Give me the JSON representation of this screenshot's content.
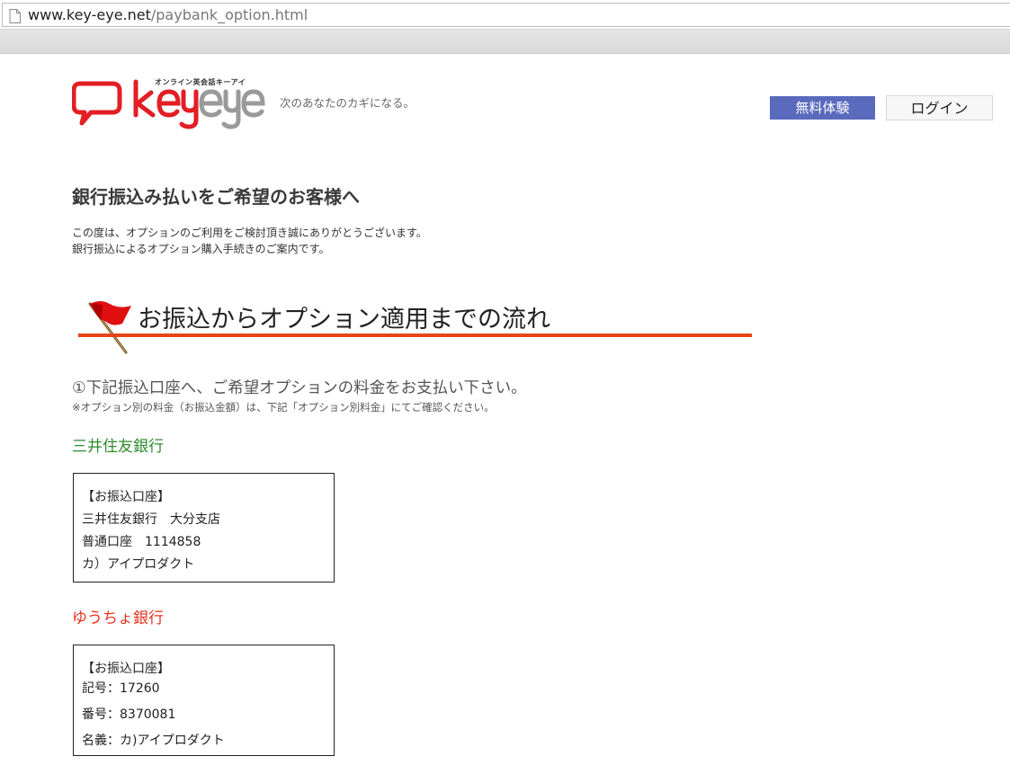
{
  "browser": {
    "url_domain": "www.key-eye.net",
    "url_path": "/paybank_option.html"
  },
  "header": {
    "logo_text": "keyeye",
    "logo_subtitle": "オンライン英会話キーアイ",
    "tagline": "次のあなたのカギになる。",
    "trial_button": "無料体験",
    "login_button": "ログイン",
    "colors": {
      "logo_red": "#e31e24",
      "logo_gray": "#9a9a9a",
      "trial_bg": "#5a6abd"
    }
  },
  "main": {
    "title": "銀行振込み払いをご希望のお客様へ",
    "intro": [
      "この度は、オプションのご利用をご検討頂き誠にありがとうございます。",
      "銀行振込によるオプション購入手続きのご案内です。"
    ],
    "section": {
      "icon": "red-flag-icon",
      "heading": "お振込からオプション適用までの流れ",
      "rule_color": "#e8441a"
    },
    "step1": {
      "text": "①下記振込口座へ、ご希望オプションの料金をお支払い下さい。",
      "note": "※オプション別の料金（お振込金額）は、下記「オプション別料金」にてご確認ください。"
    },
    "banks": [
      {
        "name": "三井住友銀行",
        "color": "#2e8b2e",
        "lines": [
          "【お振込口座】",
          "三井住友銀行　大分支店",
          "普通口座　1114858",
          "カ）アイプロダクト"
        ]
      },
      {
        "name": "ゆうちょ銀行",
        "color": "#e53320",
        "lines": [
          "【お振込口座】",
          "記号：17260",
          "番号：8370081",
          "名義：カ)アイプロダクト"
        ]
      }
    ]
  }
}
